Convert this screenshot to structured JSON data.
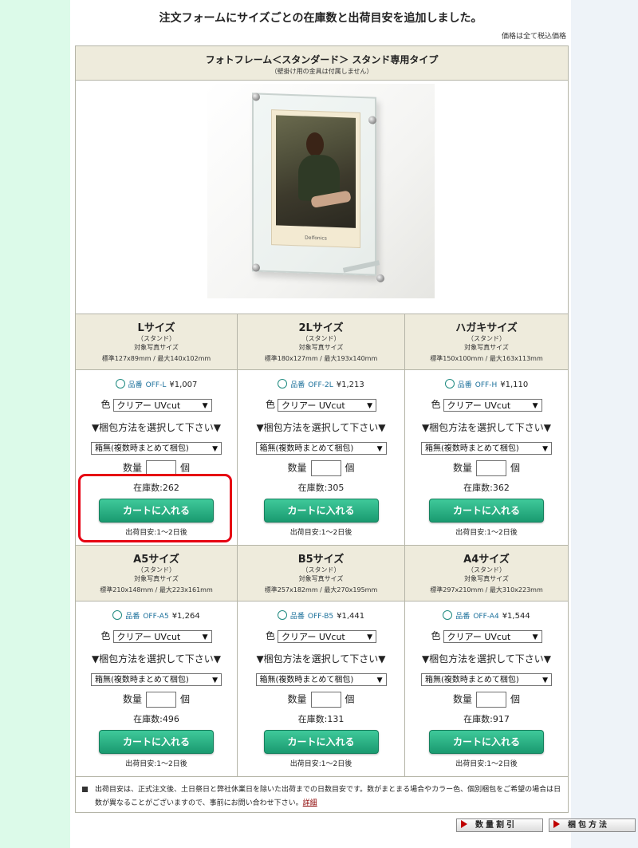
{
  "notice": "注文フォームにサイズごとの在庫数と出荷目安を追加しました。",
  "tax_note": "価格は全て税込価格",
  "product": {
    "title": "フォトフレーム＜スタンダード＞ スタンド専用タイプ",
    "subtitle": "（壁掛け用の金具は付属しません）",
    "image_caption": "Delfonics"
  },
  "labels": {
    "color": "色",
    "pack_heading": "▼梱包方法を選択して下さい▼",
    "qty": "数量",
    "qty_unit": "個",
    "cart": "カートに入れる",
    "code_prefix": "品番"
  },
  "sizes": [
    {
      "name": "Lサイズ",
      "type": "（スタンド）",
      "target": "対象写真サイズ",
      "dims": "標準127x89mm / 最大140x102mm",
      "code": "OFF-L",
      "price": "¥1,007",
      "color": "クリアー UVcut",
      "pack": "箱無(複数時まとめて梱包)",
      "stock": "在庫数:262",
      "ship": "出荷目安:1～2日後"
    },
    {
      "name": "2Lサイズ",
      "type": "（スタンド）",
      "target": "対象写真サイズ",
      "dims": "標準180x127mm / 最大193x140mm",
      "code": "OFF-2L",
      "price": "¥1,213",
      "color": "クリアー UVcut",
      "pack": "箱無(複数時まとめて梱包)",
      "stock": "在庫数:305",
      "ship": "出荷目安:1～2日後"
    },
    {
      "name": "ハガキサイズ",
      "type": "（スタンド）",
      "target": "対象写真サイズ",
      "dims": "標準150x100mm / 最大163x113mm",
      "code": "OFF-H",
      "price": "¥1,110",
      "color": "クリアー UVcut",
      "pack": "箱無(複数時まとめて梱包)",
      "stock": "在庫数:362",
      "ship": "出荷目安:1～2日後"
    },
    {
      "name": "A5サイズ",
      "type": "（スタンド）",
      "target": "対象写真サイズ",
      "dims": "標準210x148mm / 最大223x161mm",
      "code": "OFF-A5",
      "price": "¥1,264",
      "color": "クリアー UVcut",
      "pack": "箱無(複数時まとめて梱包)",
      "stock": "在庫数:496",
      "ship": "出荷目安:1～2日後"
    },
    {
      "name": "B5サイズ",
      "type": "（スタンド）",
      "target": "対象写真サイズ",
      "dims": "標準257x182mm / 最大270x195mm",
      "code": "OFF-B5",
      "price": "¥1,441",
      "color": "クリアー UVcut",
      "pack": "箱無(複数時まとめて梱包)",
      "stock": "在庫数:131",
      "ship": "出荷目安:1～2日後"
    },
    {
      "name": "A4サイズ",
      "type": "（スタンド）",
      "target": "対象写真サイズ",
      "dims": "標準297x210mm / 最大310x223mm",
      "code": "OFF-A4",
      "price": "¥1,544",
      "color": "クリアー UVcut",
      "pack": "箱無(複数時まとめて梱包)",
      "stock": "在庫数:917",
      "ship": "出荷目安:1～2日後"
    }
  ],
  "note": {
    "text": "出荷目安は、正式注文後、土日祭日と弊社休業日を除いた出荷までの日数目安です。数がまとまる場合やカラー色、個別梱包をご希望の場合は日数が異なることがございますので、事前にお問い合わせ下さい。",
    "link": "詳細"
  },
  "buttons": {
    "qty_discount": "数量割引",
    "pack_method": "梱包方法"
  },
  "colors": {
    "cart_button": "#24b07f",
    "header_bg": "#eeebdc",
    "highlight": "#e60012",
    "code_text": "#1a6f9a"
  }
}
